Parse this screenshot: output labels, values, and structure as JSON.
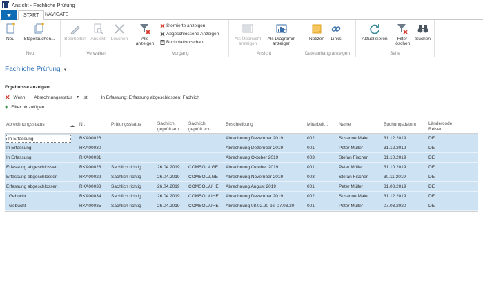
{
  "window": {
    "title": "Ansicht - Fachliche Prüfung"
  },
  "tabs": [
    {
      "label": "START",
      "active": true
    },
    {
      "label": "NAVIGATE",
      "active": false
    }
  ],
  "ribbon": {
    "groups": {
      "neu": "Neu",
      "verwalten": "Verwalten",
      "vorgang": "Vorgang",
      "ansicht": "Ansicht",
      "dateianhang": "Dateianhang anzeigen",
      "seite": "Seite"
    },
    "buttons": {
      "neu": "Neu",
      "stapelbuchen": "Stapelbuchen...",
      "bearbeiten": "Bearbeiten",
      "ansicht": "Ansicht",
      "loeschen": "Löschen",
      "alle_anzeigen_1": "Alle",
      "alle_anzeigen_2": "anzeigen",
      "storn": "Stornierte anzeigen",
      "abgeschl": "Abgeschlossene Anzeigen",
      "buchblatt": "Buchblattvorschau",
      "uebersicht_1": "Als Übersicht",
      "uebersicht_2": "anzeigen",
      "diagramm_1": "Als Diagramm",
      "diagramm_2": "anzeigen",
      "notizen": "Notizen",
      "links": "Links",
      "aktualisieren": "Aktualisieren",
      "filter_1": "Filter",
      "filter_2": "löschen",
      "suchen": "Suchen"
    }
  },
  "page": {
    "title": "Fachliche Prüfung"
  },
  "filter": {
    "heading": "Ergebnisse anzeigen:",
    "when": "Wenn",
    "field": "Abrechnungsstatus",
    "operator": "ist",
    "value": "In Erfassung; Erfassung abgeschlossen; Fachlich",
    "add": "Filter hinzufügen"
  },
  "table": {
    "columns": [
      "Abrechnungsstatus",
      "Nr.",
      "Prüfungsstatus",
      "Sachlich|geprüft am",
      "Sachlich|geprüft von",
      "Beschreibung",
      "Mitarbeit...",
      "Name",
      "Buchungsdatum",
      "Ländercode|Reisen"
    ],
    "rows": [
      [
        "In Erfassung",
        "RKA00026",
        "",
        "",
        "",
        "Abrechnung Dezember 2019",
        "002",
        "Susanne Maier",
        "31.12.2019",
        "DE"
      ],
      [
        "In Erfassung",
        "RKA00030",
        "",
        "",
        "",
        "Abrechnung Dezember 2019",
        "001",
        "Peter Müller",
        "31.12.2019",
        "DE"
      ],
      [
        "In Erfassung",
        "RKA00031",
        "",
        "",
        "",
        "Abrechnung Oktober 2019",
        "003",
        "Stefan Fischer",
        "31.10.2019",
        "DE"
      ],
      [
        "Erfassung abgeschlossen",
        "RKA00028",
        "Sachlich richtig",
        "26.04.2019",
        "COMSOL\\LGE",
        "Abrechnung Oktober 2019",
        "001",
        "Peter Müller",
        "31.10.2019",
        "DE"
      ],
      [
        "Erfassung abgeschlossen",
        "RKA00029",
        "Sachlich richtig",
        "26.04.2019",
        "COMSOL\\LGE",
        "Abrechnung November 2019",
        "003",
        "Stefan Fischer",
        "30.11.2019",
        "DE"
      ],
      [
        "Erfassung abgeschlossen",
        "RKA00033",
        "Sachlich richtig",
        "26.04.2019",
        "COMSOL\\UHE",
        "Abrechnung August 2019",
        "001",
        "Peter Müller",
        "31.08.2019",
        "DE"
      ],
      [
        "Gebucht",
        "RKA00034",
        "Sachlich richtig",
        "26.04.2019",
        "COMSOL\\UHE",
        "Abrechnung Dezember 2019",
        "002",
        "Susanne Maier",
        "31.12.2019",
        "DE"
      ],
      [
        "Gebucht",
        "RKA00035",
        "Sachlich richtig",
        "26.04.2019",
        "COMSOL\\UHE",
        "Abrechnung 08.02.20 bis 07.03.20",
        "001",
        "Peter Müller",
        "07.03.2020",
        "DE"
      ]
    ]
  },
  "colors": {
    "accent": "#0e6cb4",
    "title_blue": "#2c72b8",
    "row_selected": "#cde2f3",
    "remove_red": "#d23b2b",
    "add_green": "#2e8b3f"
  },
  "icons": [
    "app-icon",
    "new-icon",
    "batch-post-icon",
    "edit-icon",
    "view-icon",
    "delete-icon",
    "show-all-filter-icon",
    "cancelled-icon",
    "closed-icon",
    "preview-icon",
    "list-view-icon",
    "chart-view-icon",
    "notes-icon",
    "links-icon",
    "refresh-icon",
    "clear-filter-icon",
    "search-binoculars-icon"
  ]
}
